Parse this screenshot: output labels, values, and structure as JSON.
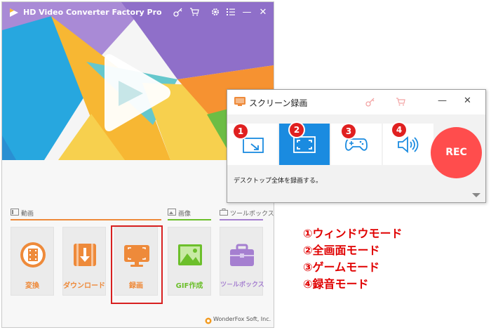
{
  "app": {
    "title": "HD Video Converter Factory Pro",
    "footer": "WonderFox Soft, Inc."
  },
  "sections": [
    {
      "label": "動画"
    },
    {
      "label": "画像"
    },
    {
      "label": "ツールボックス"
    }
  ],
  "tiles": [
    {
      "label": "変換",
      "icon": "film-reel-icon",
      "color": "#ee8a3a"
    },
    {
      "label": "ダウンロード",
      "icon": "download-icon",
      "color": "#ee8a3a"
    },
    {
      "label": "録画",
      "icon": "monitor-record-icon",
      "color": "#ee8a3a"
    },
    {
      "label": "GIF作成",
      "icon": "image-icon",
      "color": "#6cbf2b"
    },
    {
      "label": "ツ－ルボックス",
      "icon": "toolbox-icon",
      "color": "#a57fd0"
    }
  ],
  "recorder": {
    "title": "スクリーン録画",
    "modes": [
      {
        "number": "1",
        "icon": "window-mode-icon"
      },
      {
        "number": "2",
        "icon": "fullscreen-mode-icon"
      },
      {
        "number": "3",
        "icon": "game-mode-icon"
      },
      {
        "number": "4",
        "icon": "audio-mode-icon"
      }
    ],
    "rec_label": "REC",
    "description": "デスクトップ全体を録画する。",
    "selected_mode": 2
  },
  "legend": [
    "①ウィンドウモード",
    "②全画面モード",
    "③ゲームモード",
    "④録音モード"
  ],
  "colors": {
    "accent_blue": "#1a8be0",
    "highlight_red": "#d82020",
    "rec_red": "#ff4d4d",
    "video_orange": "#ee8a3a",
    "image_green": "#6cbf2b",
    "toolbox_purple": "#a57fd0"
  }
}
